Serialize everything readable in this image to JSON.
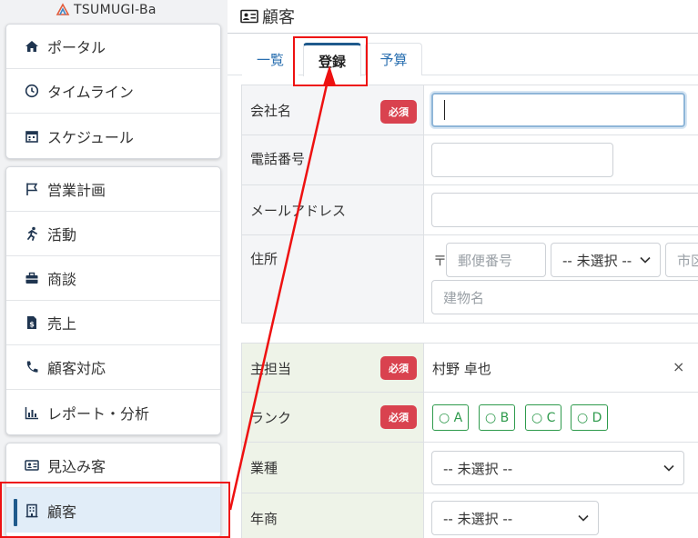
{
  "app": {
    "logo_text": "TSUMUGI-Ba"
  },
  "sidebar": {
    "groups": [
      [
        {
          "label": "ポータル",
          "icon": "home-icon"
        },
        {
          "label": "タイムライン",
          "icon": "clock-icon"
        },
        {
          "label": "スケジュール",
          "icon": "calendar-icon"
        }
      ],
      [
        {
          "label": "営業計画",
          "icon": "flag-icon"
        },
        {
          "label": "活動",
          "icon": "running-icon"
        },
        {
          "label": "商談",
          "icon": "briefcase-icon"
        },
        {
          "label": "売上",
          "icon": "invoice-icon"
        },
        {
          "label": "顧客対応",
          "icon": "phone-icon"
        },
        {
          "label": "レポート・分析",
          "icon": "bar-chart-icon"
        }
      ],
      [
        {
          "label": "見込み客",
          "icon": "id-card-icon"
        },
        {
          "label": "顧客",
          "icon": "building-icon",
          "active": true
        }
      ]
    ]
  },
  "header": {
    "title": "顧客"
  },
  "tabs": [
    {
      "label": "一覧"
    },
    {
      "label": "登録",
      "active": true
    },
    {
      "label": "予算"
    }
  ],
  "form": {
    "required_badge": "必須",
    "company": {
      "label": "会社名",
      "value": ""
    },
    "phone": {
      "label": "電話番号",
      "value": ""
    },
    "email": {
      "label": "メールアドレス",
      "value": ""
    },
    "address": {
      "label": "住所",
      "postal_mark": "〒",
      "postal_placeholder": "郵便番号",
      "prefecture_value": "-- 未選択 --",
      "city_placeholder": "市区",
      "building_placeholder": "建物名"
    },
    "owner": {
      "label": "主担当",
      "value": "村野 卓也",
      "clear": "×"
    },
    "rank": {
      "label": "ランク",
      "options": [
        "A",
        "B",
        "C",
        "D"
      ]
    },
    "industry": {
      "label": "業種",
      "value": "-- 未選択 --"
    },
    "revenue": {
      "label": "年商",
      "value": "-- 未選択 --"
    }
  },
  "colors": {
    "accent": "#1f5a8c",
    "required": "#d9424f",
    "annotation": "#ee1111",
    "rank_chip": "#2e9a4c"
  }
}
